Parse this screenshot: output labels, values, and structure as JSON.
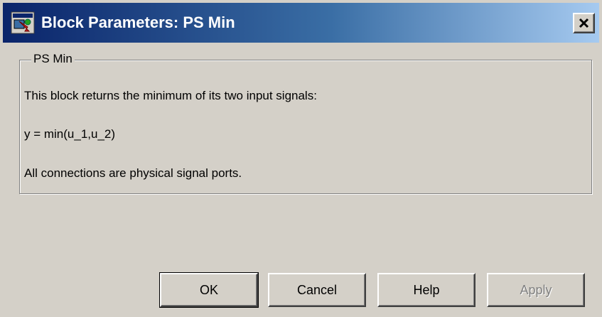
{
  "window": {
    "title": "Block Parameters: PS Min",
    "app_icon": "simulink-block-icon",
    "close_icon": "close-icon",
    "colors": {
      "title_bar_start": "#0a246a",
      "title_bar_end": "#a6caf0",
      "dialog_background": "#d4d0c8"
    }
  },
  "group": {
    "legend": "PS Min",
    "lines": [
      "This block returns the minimum of its two input signals:",
      "y = min(u_1,u_2)",
      "All connections are physical signal ports."
    ]
  },
  "buttons": {
    "ok_label": "OK",
    "cancel_label": "Cancel",
    "help_label": "Help",
    "apply_label": "Apply",
    "apply_enabled": false
  }
}
